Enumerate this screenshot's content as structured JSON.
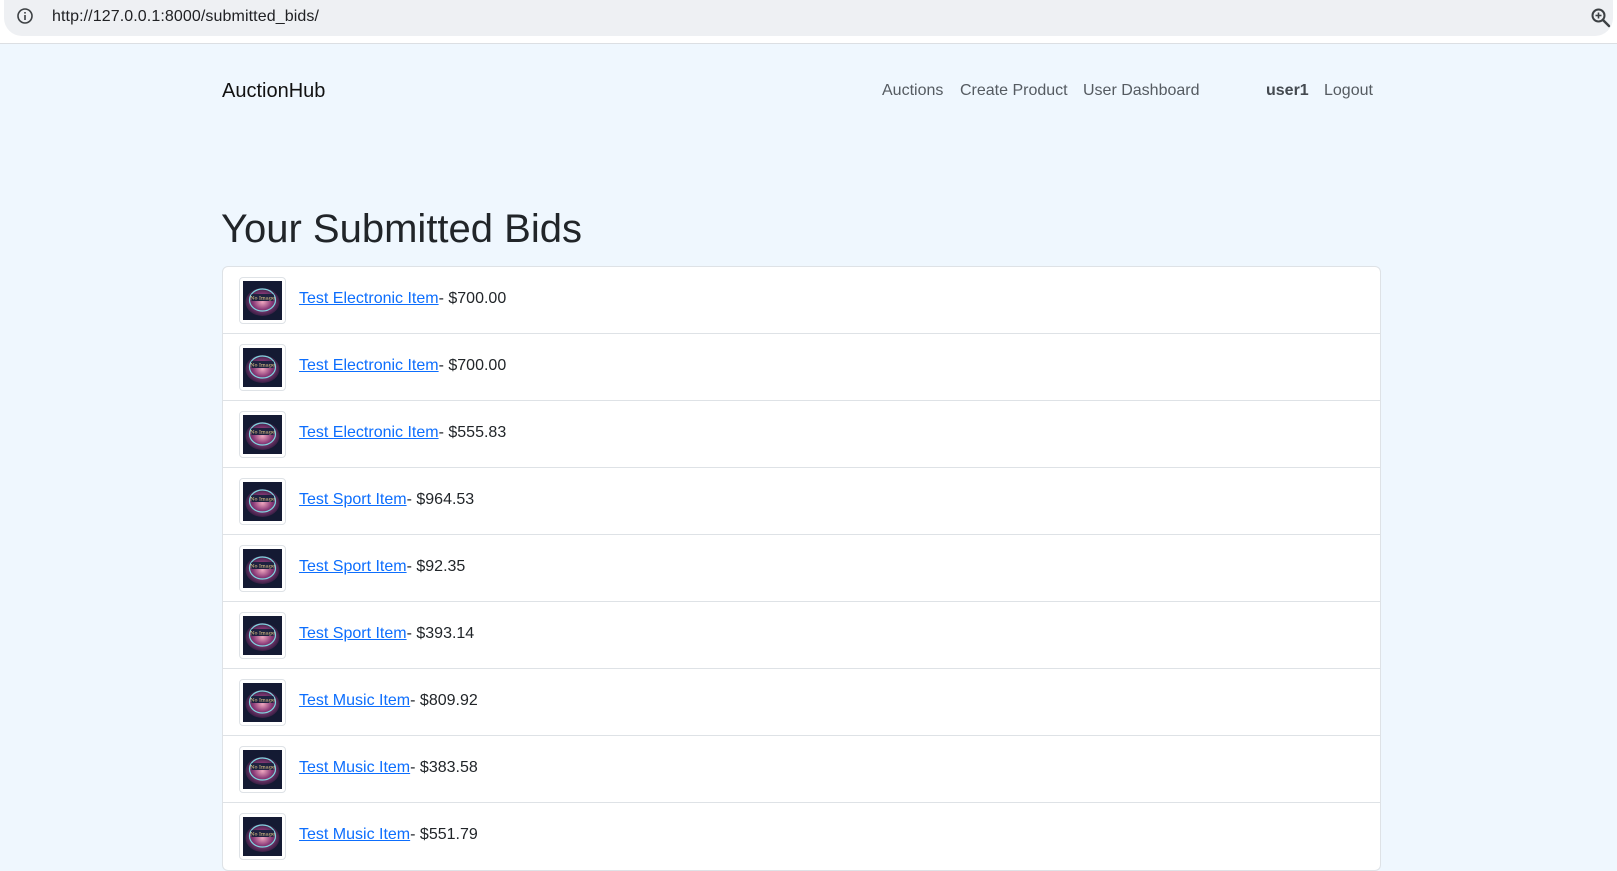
{
  "browser": {
    "url": "http://127.0.0.1:8000/submitted_bids/",
    "info_icon": "info-icon",
    "zoom_icon": "zoom-icon"
  },
  "navbar": {
    "brand": "AuctionHub",
    "links": [
      "Auctions",
      "Create Product",
      "User Dashboard"
    ],
    "username": "user1",
    "logout": "Logout"
  },
  "page": {
    "title": "Your Submitted Bids"
  },
  "bids": [
    {
      "product": "Test Electronic Item",
      "amount": "- $700.00"
    },
    {
      "product": "Test Electronic Item",
      "amount": "- $700.00"
    },
    {
      "product": "Test Electronic Item",
      "amount": "- $555.83"
    },
    {
      "product": "Test Sport Item",
      "amount": "- $964.53"
    },
    {
      "product": "Test Sport Item",
      "amount": "- $92.35"
    },
    {
      "product": "Test Sport Item",
      "amount": "- $393.14"
    },
    {
      "product": "Test Music Item",
      "amount": "- $809.92"
    },
    {
      "product": "Test Music Item",
      "amount": "- $383.58"
    },
    {
      "product": "Test Music Item",
      "amount": "- $551.79"
    }
  ],
  "thumbnail_icon": "no-image-placeholder-icon"
}
